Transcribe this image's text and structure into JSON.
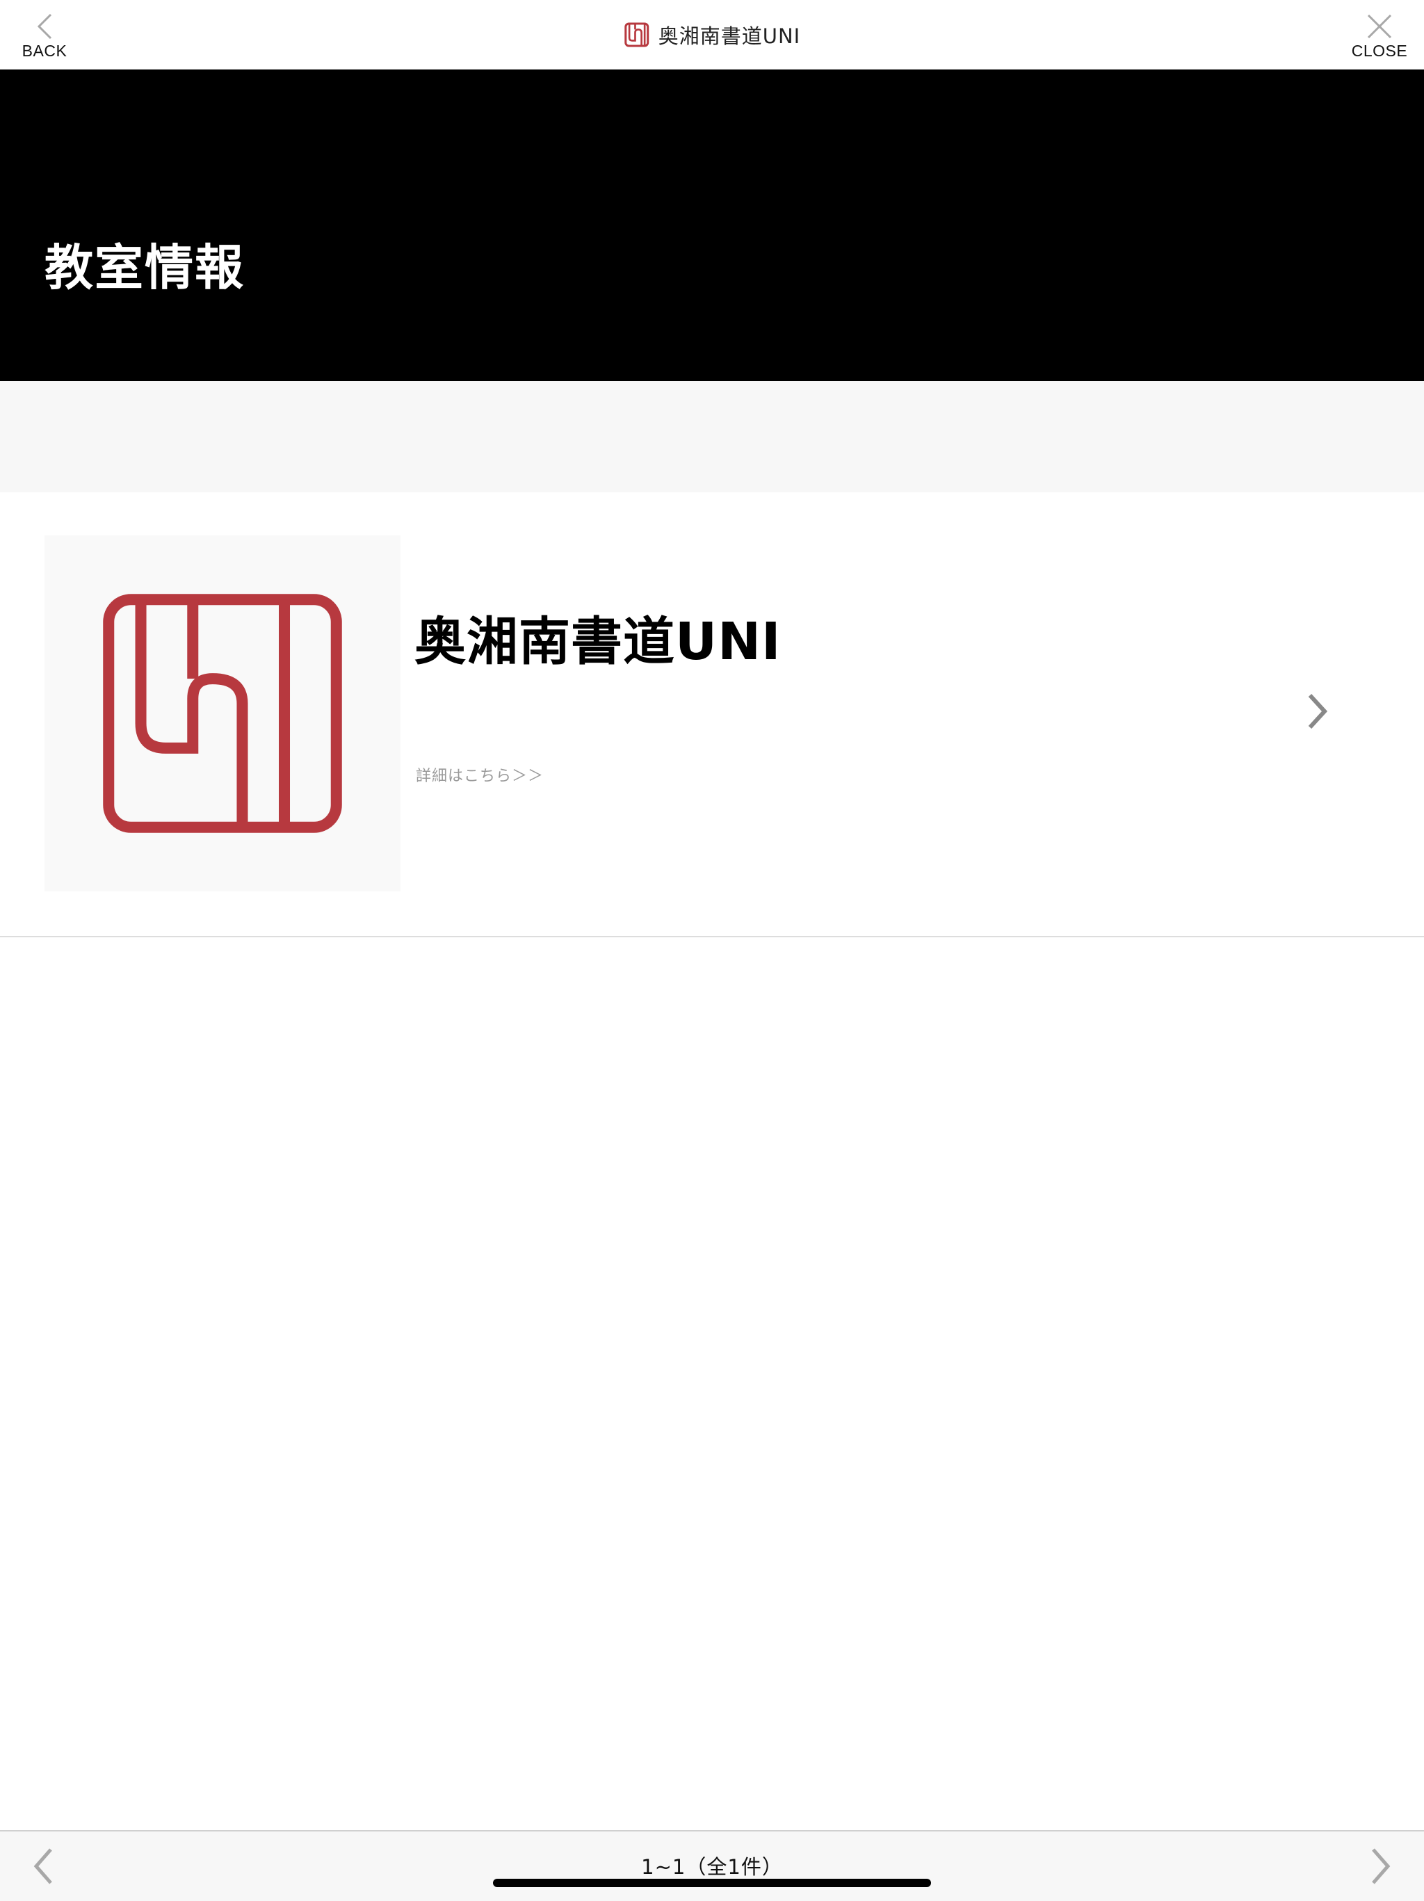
{
  "header": {
    "back_label": "BACK",
    "close_label": "CLOSE",
    "brand_name": "奥湘南書道UNI",
    "back_icon": "chevron-left-icon",
    "close_icon": "close-x-icon",
    "brand_icon": "school-logo-icon"
  },
  "hero": {
    "title": "教室情報"
  },
  "list": {
    "items": [
      {
        "title": "奥湘南書道UNI",
        "link_text": "詳細はこちら＞＞",
        "thumbnail_icon": "school-logo-icon",
        "chevron_icon": "chevron-right-icon"
      }
    ]
  },
  "pager": {
    "info": "1~1（全1件）",
    "prev_icon": "chevron-left-icon",
    "next_icon": "chevron-right-icon"
  },
  "colors": {
    "brand_red": "#b7393f",
    "hero_background": "#000000",
    "gap_background": "#f7f7f7",
    "link_gray": "#9a9a9a",
    "icon_gray": "#a8a8a8"
  }
}
